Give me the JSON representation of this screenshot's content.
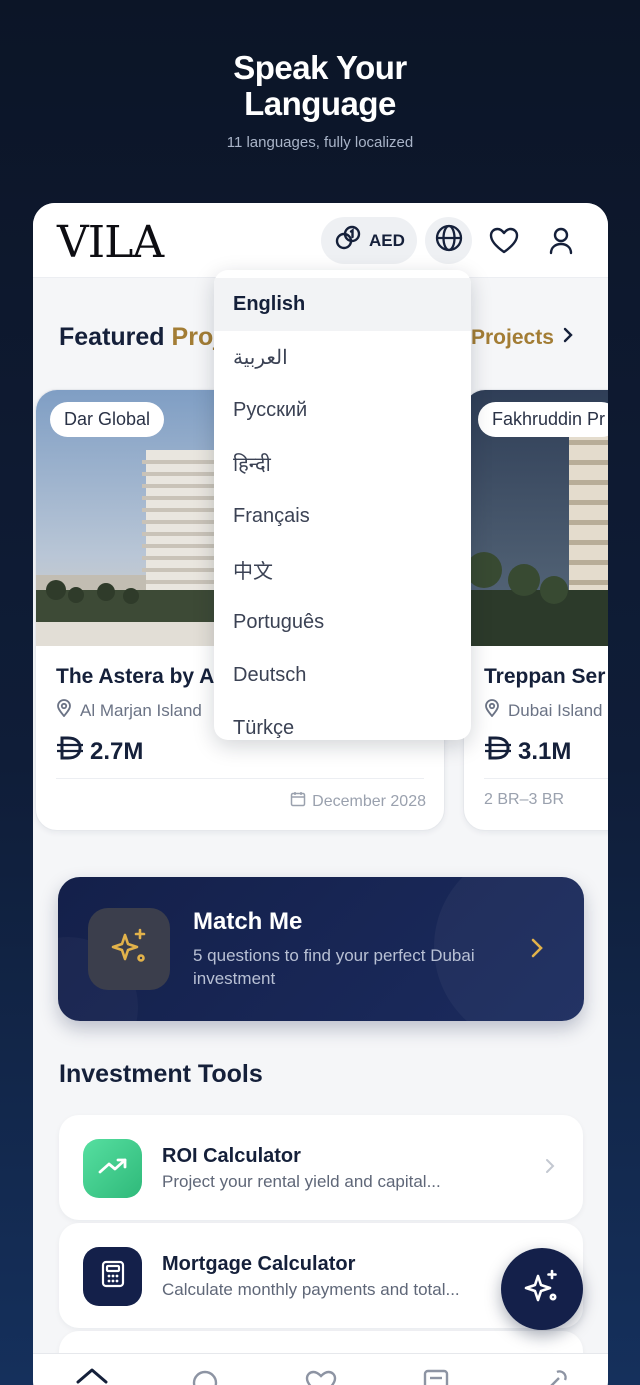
{
  "promo": {
    "title_line1": "Speak Your",
    "title_line2": "Language",
    "subtitle": "11 languages, fully localized"
  },
  "header": {
    "logo": "VILA",
    "currency": "AED",
    "icons": [
      "currency-icon",
      "globe-icon",
      "heart-icon",
      "user-icon"
    ]
  },
  "featured": {
    "title_main": "Featured",
    "title_accent": "Proj",
    "see_all": "Projects"
  },
  "projects": [
    {
      "developer": "Dar Global",
      "name": "The Astera by A",
      "location": "Al Marjan Island",
      "price": "2.7M",
      "meta": "December 2028"
    },
    {
      "developer": "Fakhruddin Pr",
      "name": "Treppan Ser",
      "location": "Dubai Island",
      "price": "3.1M",
      "meta": "2 BR–3 BR"
    }
  ],
  "language_menu": {
    "selected": "English",
    "items": [
      "English",
      "العربية",
      "Русский",
      "हिन्दी",
      "Français",
      "中文",
      "Português",
      "Deutsch",
      "Türkçe"
    ]
  },
  "match_me": {
    "title": "Match Me",
    "description": "5 questions to find your perfect Dubai investment"
  },
  "tools": {
    "title": "Investment Tools",
    "items": [
      {
        "title": "ROI Calculator",
        "description": "Project your rental yield and capital..."
      },
      {
        "title": "Mortgage Calculator",
        "description": "Calculate monthly payments and total..."
      }
    ]
  },
  "colors": {
    "accent": "#a37d35",
    "navy": "#14204a",
    "roi_green": "#3ecf8e"
  }
}
